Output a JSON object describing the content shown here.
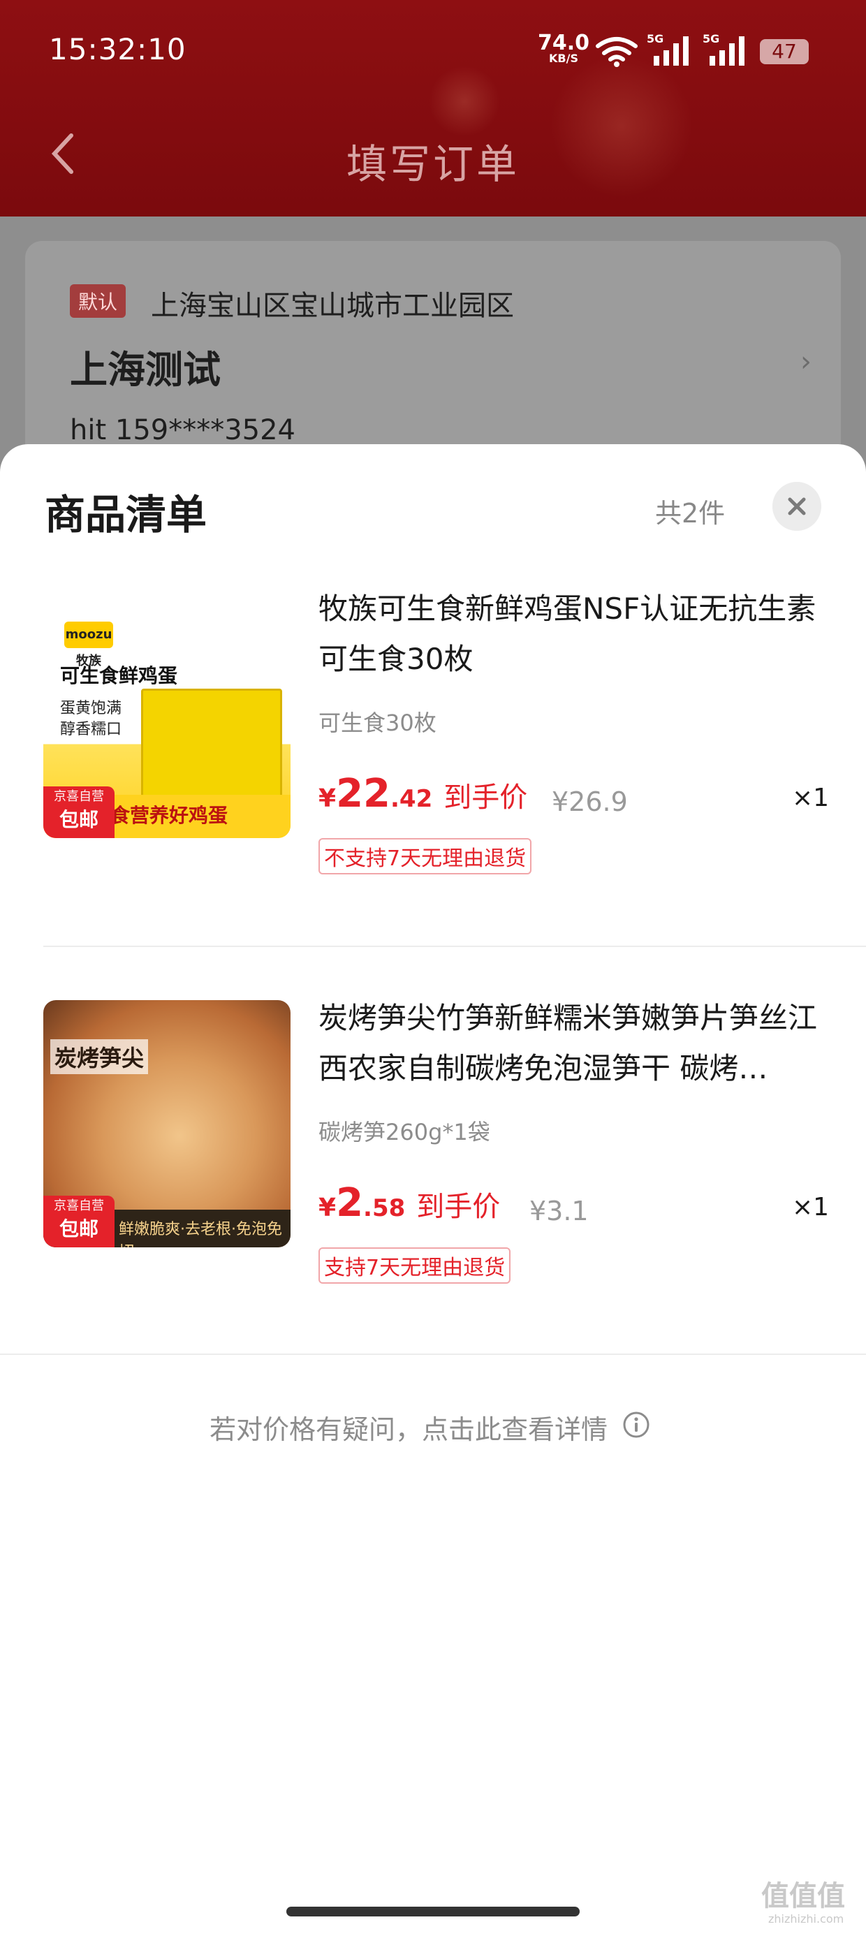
{
  "status_bar": {
    "time": "15:32:10",
    "net_speed": "74.0",
    "net_unit": "KB/S",
    "sig1_label": "5G",
    "sig2_label": "5G",
    "battery": "47"
  },
  "header": {
    "title": "填写订单"
  },
  "address": {
    "default_tag": "默认",
    "line": "上海宝山区宝山城市工业园区",
    "name": "上海测试",
    "phone": "hit  159****3524",
    "arrow": "›"
  },
  "sheet": {
    "title": "商品清单",
    "count": "共2件"
  },
  "items": [
    {
      "image_headline": "可生食鲜鸡蛋",
      "image_sub1": "蛋黄饱满",
      "image_sub2": "醇香糯口",
      "image_logo": "moozu 牧族",
      "image_band": "食营养好鸡蛋",
      "badge_top": "京喜自营",
      "badge_bottom": "包邮",
      "title": "牧族可生食新鲜鸡蛋NSF认证无抗生素 可生食30枚",
      "spec": "可生食30枚",
      "price_yen": "¥",
      "price_int": "22",
      "price_dec": ".42",
      "price_label": "到手价",
      "orig_price": "¥26.9",
      "qty": "×1",
      "tag": "不支持7天无理由退货"
    },
    {
      "image_headline": "炭烤笋尖",
      "image_band": "鲜嫩脆爽·去老根·免泡免切",
      "badge_top": "京喜自营",
      "badge_bottom": "包邮",
      "title": "炭烤笋尖竹笋新鲜糯米笋嫩笋片笋丝江西农家自制碳烤免泡湿笋干 碳烤…",
      "spec": "碳烤笋260g*1袋",
      "price_yen": "¥",
      "price_int": "2",
      "price_dec": ".58",
      "price_label": "到手价",
      "orig_price": "¥3.1",
      "qty": "×1",
      "tag": "支持7天无理由退货"
    }
  ],
  "footer": {
    "help_text": "若对价格有疑问，点击此查看详情",
    "watermark": "值值值",
    "watermark_sub": "zhizhizhi.com"
  },
  "colors": {
    "brand_red": "#8e0f12",
    "price_red": "#e4222a",
    "muted": "#8c8c8c"
  }
}
